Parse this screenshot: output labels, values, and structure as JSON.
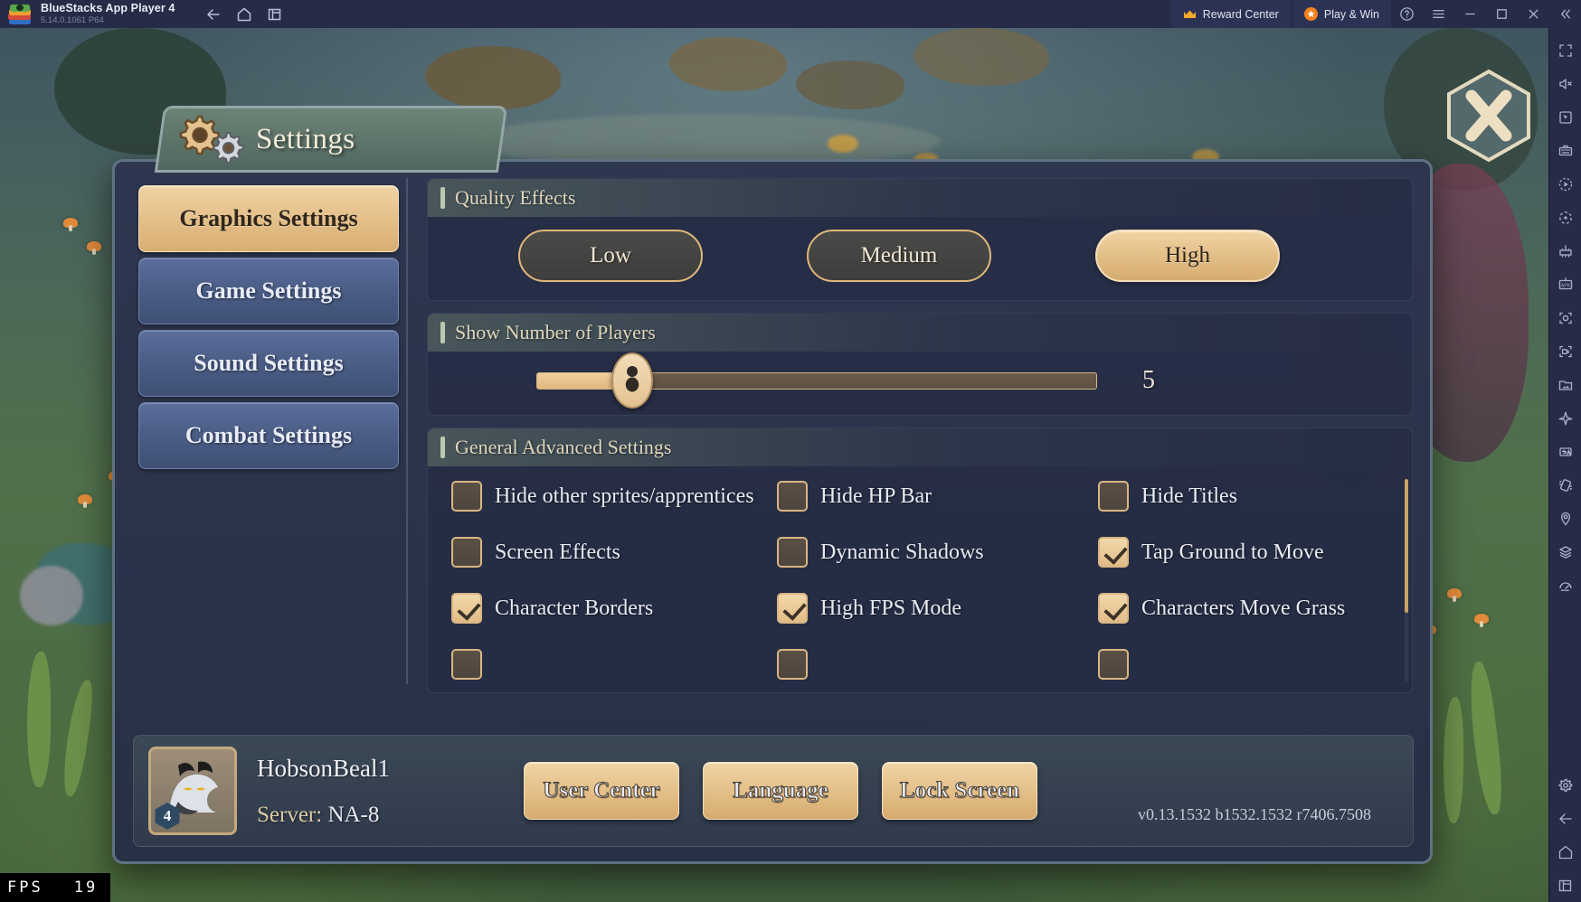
{
  "titlebar": {
    "app_name": "BlueStacks App Player 4",
    "app_version": "5.14.0.1061  P64",
    "nav": [
      {
        "name": "back-button",
        "icon": "back-arrow-icon"
      },
      {
        "name": "home-button",
        "icon": "home-icon"
      },
      {
        "name": "instances-button",
        "icon": "multi-instance-icon"
      }
    ],
    "reward_center_label": "Reward Center",
    "play_and_win_label": "Play & Win",
    "window_buttons": [
      {
        "name": "help-button",
        "icon": "question-circle-icon"
      },
      {
        "name": "menu-button",
        "icon": "hamburger-menu-icon"
      },
      {
        "name": "minimize-button",
        "icon": "minimize-icon"
      },
      {
        "name": "maximize-button",
        "icon": "maximize-icon"
      },
      {
        "name": "close-button",
        "icon": "close-icon"
      },
      {
        "name": "collapse-sidebar-button",
        "icon": "double-chevron-left-icon"
      }
    ]
  },
  "dialog": {
    "title": "Settings",
    "close_label": "X",
    "sidebar": {
      "items": [
        {
          "label": "Graphics Settings",
          "active": true
        },
        {
          "label": "Game Settings",
          "active": false
        },
        {
          "label": "Sound Settings",
          "active": false
        },
        {
          "label": "Combat Settings",
          "active": false
        }
      ]
    },
    "quality": {
      "heading": "Quality Effects",
      "options": [
        {
          "label": "Low",
          "selected": false
        },
        {
          "label": "Medium",
          "selected": false
        },
        {
          "label": "High",
          "selected": true
        }
      ]
    },
    "players": {
      "heading": "Show Number of Players",
      "value": "5",
      "fill_percent": 17
    },
    "advanced": {
      "heading": "General Advanced Settings",
      "checkboxes": [
        {
          "label": "Hide other sprites/apprentices",
          "checked": false
        },
        {
          "label": "Hide HP Bar",
          "checked": false
        },
        {
          "label": "Hide Titles",
          "checked": false
        },
        {
          "label": "Screen Effects",
          "checked": false
        },
        {
          "label": "Dynamic Shadows",
          "checked": false
        },
        {
          "label": "Tap Ground to Move",
          "checked": true
        },
        {
          "label": "Character Borders",
          "checked": true
        },
        {
          "label": "High FPS Mode",
          "checked": true
        },
        {
          "label": "Characters Move Grass",
          "checked": true
        }
      ]
    },
    "account": {
      "username": "HobsonBeal1",
      "server_label": "Server:",
      "server_value": "NA-8",
      "level": "4",
      "buttons": [
        {
          "label": "User Center"
        },
        {
          "label": "Language"
        },
        {
          "label": "Lock Screen"
        }
      ]
    },
    "version_string": "v0.13.1532 b1532.1532 r7406.7508"
  },
  "overlay": {
    "fps_label": "FPS",
    "fps_value": "19"
  },
  "right_toolbar": {
    "items": [
      {
        "name": "fullscreen-icon"
      },
      {
        "name": "mute-icon"
      },
      {
        "name": "cursor-icon"
      },
      {
        "name": "keyboard-controls-icon"
      },
      {
        "name": "macro-play-icon"
      },
      {
        "name": "rotate-icon"
      },
      {
        "name": "multi-instance-manager-icon"
      },
      {
        "name": "install-apk-icon"
      },
      {
        "name": "screenshot-icon"
      },
      {
        "name": "record-screen-icon"
      },
      {
        "name": "media-manager-icon"
      },
      {
        "name": "eco-mode-icon"
      },
      {
        "name": "real-time-translate-icon"
      },
      {
        "name": "shake-icon"
      },
      {
        "name": "location-icon"
      },
      {
        "name": "layers-icon"
      },
      {
        "name": "performance-icon"
      },
      {
        "name": "settings-gear-icon"
      },
      {
        "name": "back-arrow-icon"
      },
      {
        "name": "home-icon"
      },
      {
        "name": "recent-apps-icon"
      }
    ]
  },
  "colors": {
    "accent_gold": "#e3be87",
    "panel_bg": "#252c44",
    "titlebar_bg": "#262b47",
    "sidebar_blue": "#4b5d86"
  }
}
